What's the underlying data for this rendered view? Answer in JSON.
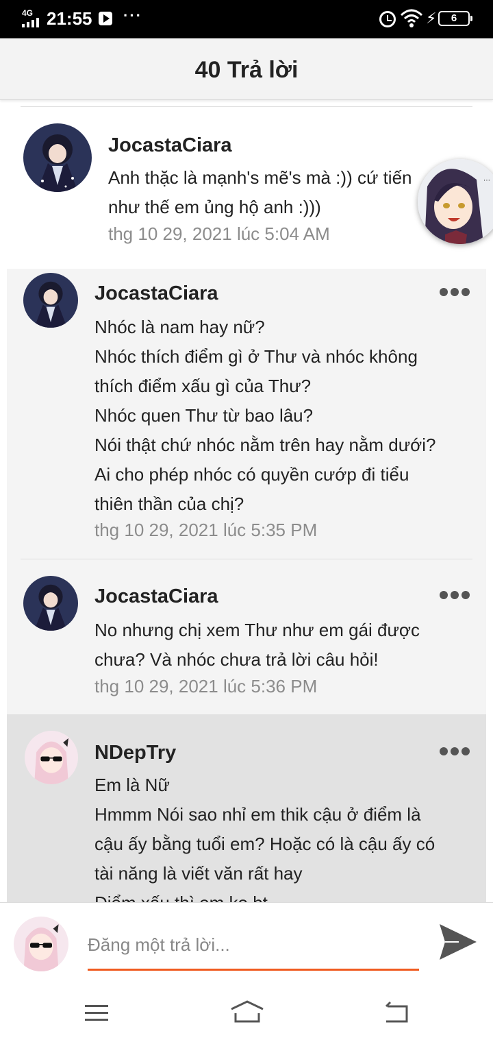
{
  "status_bar": {
    "network": "4G",
    "time": "21:55",
    "more": "···",
    "battery": "6"
  },
  "header": {
    "title": "40 Trả lời"
  },
  "comments": [
    {
      "username": "JocastaCiara",
      "lines": [
        "Anh thặc là mạnh's mẽ's mà :)) cứ tiến",
        "như thế em ủng hộ anh :)))"
      ],
      "timestamp": "thg 10 29, 2021 lúc 5:04 AM"
    },
    {
      "username": "JocastaCiara",
      "lines": [
        "Nhóc là nam hay nữ?",
        "Nhóc thích điểm gì ở Thư và nhóc không",
        "thích điểm xấu gì của Thư?",
        "Nhóc quen Thư từ bao lâu?",
        "Nói thật chứ nhóc nằm trên hay nằm dưới?",
        "Ai cho phép nhóc có quyền cướp đi tiểu",
        "thiên thần của chị?"
      ],
      "timestamp": "thg 10 29, 2021 lúc 5:35 PM"
    },
    {
      "username": "JocastaCiara",
      "lines": [
        "No nhưng chị xem Thư như em gái được",
        "chưa? Và nhóc chưa trả lời câu hỏi!"
      ],
      "timestamp": "thg 10 29, 2021 lúc 5:36 PM"
    },
    {
      "username": "NDepTry",
      "lines": [
        "Em là Nữ",
        "Hmmm Nói sao nhỉ em thik cậu ở điểm là",
        "cậu ấy bằng tuổi em? Hoặc có là cậu ấy có",
        "tài năng là viết văn rất hay",
        "Điểm xấu thì em ko bt"
      ]
    }
  ],
  "composer": {
    "placeholder": "Đăng một trả lời..."
  },
  "colors": {
    "accent": "#f05a1f",
    "reply_bg": "#f4f4f4",
    "highlight_bg": "#e2e2e2",
    "timestamp": "#8c8c8c"
  },
  "icons": {
    "send": "send-icon",
    "menu": "menu-icon",
    "home": "home-icon",
    "back": "back-icon"
  }
}
